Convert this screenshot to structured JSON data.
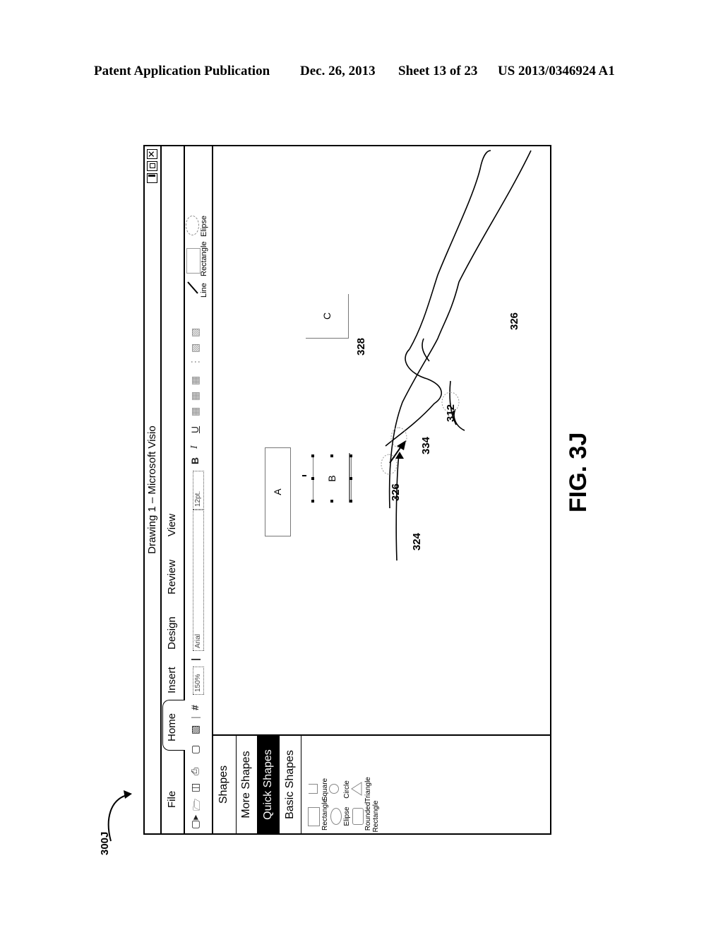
{
  "page_header": {
    "publication": "Patent Application Publication",
    "date": "Dec. 26, 2013",
    "sheet": "Sheet 13 of 23",
    "number": "US 2013/0346924 A1"
  },
  "figure": {
    "ref_label": "300J",
    "caption": "FIG. 3J"
  },
  "window": {
    "title": "Drawing 1 – Microsoft Visio",
    "controls": [
      "minimize-icon",
      "maximize-icon",
      "close-icon"
    ],
    "close_glyph": "✕"
  },
  "tabs": [
    {
      "label": "File"
    },
    {
      "label": "Home",
      "active": true
    },
    {
      "label": "Insert"
    },
    {
      "label": "Design"
    },
    {
      "label": "Review"
    },
    {
      "label": "View"
    }
  ],
  "toolbar": {
    "zoom_value": "150%",
    "font_value": "Arial",
    "size_value": "12pt.",
    "bold": "B",
    "italic": "I",
    "underline": "U",
    "quick_shapes": [
      "Line",
      "Rectangle",
      "Elipse"
    ]
  },
  "shapes_panel": {
    "title": "Shapes",
    "categories": [
      {
        "label": "More Shapes"
      },
      {
        "label": "Quick Shapes",
        "selected": true
      },
      {
        "label": "Basic Shapes"
      }
    ],
    "items": [
      {
        "label": "Rectangle"
      },
      {
        "label": "Square"
      },
      {
        "label": "Elipse"
      },
      {
        "label": "Circle"
      },
      {
        "label": "Rounded Rectangle"
      },
      {
        "label": "Triangle"
      }
    ]
  },
  "canvas": {
    "shapes": [
      {
        "label": "A"
      },
      {
        "label": "B"
      },
      {
        "label": "C"
      }
    ],
    "reference_numerals": [
      "328",
      "326",
      "312",
      "334",
      "326",
      "324"
    ]
  }
}
